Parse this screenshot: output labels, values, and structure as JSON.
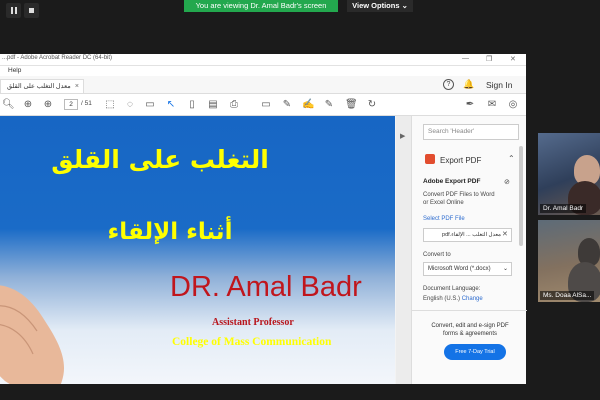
{
  "zoom": {
    "banner": "You are viewing Dr. Amal  Badr's screen",
    "view_options": "View Options ⌄"
  },
  "acrobat": {
    "window_title": "...pdf - Adobe Acrobat Reader DC (64-bit)",
    "menu_help": "Help",
    "tab_label": "معدل التغلب على القلق",
    "sign_in": "Sign In",
    "page_current": "2",
    "page_total": "/ 51"
  },
  "slide": {
    "title_line1": "التغلب على القلق",
    "title_line2": "أثناء الإلقاء",
    "name": "DR. Amal Badr",
    "role": "Assistant Professor",
    "college": "College of Mass Communication"
  },
  "right_pane": {
    "search_placeholder": "Search 'Header'",
    "export_title": "Export PDF",
    "section_title": "Adobe Export PDF",
    "desc_line1": "Convert PDF Files to Word",
    "desc_line2": "or Excel Online",
    "select_file_label": "Select PDF File",
    "file_name": "معدل التغلب ... الإلقاء.pdf",
    "convert_to_label": "Convert to",
    "convert_to_value": "Microsoft Word (*.docx)",
    "doc_lang_label": "Document Language:",
    "doc_lang_value": "English (U.S.)",
    "change_link": "Change",
    "promo_line1": "Convert, edit and e-sign PDF",
    "promo_line2": "forms & agreements",
    "trial_button": "Free 7-Day Trial"
  },
  "participants": [
    {
      "name": "Dr. Amal  Badr"
    },
    {
      "name": "Ms. Doaa AlSa..."
    }
  ],
  "colors": {
    "banner_green": "#23a84e",
    "slide_blue": "#1766c4",
    "title_yellow": "#ffff00",
    "name_red": "#c0161d",
    "acrobat_blue": "#1473e6"
  }
}
